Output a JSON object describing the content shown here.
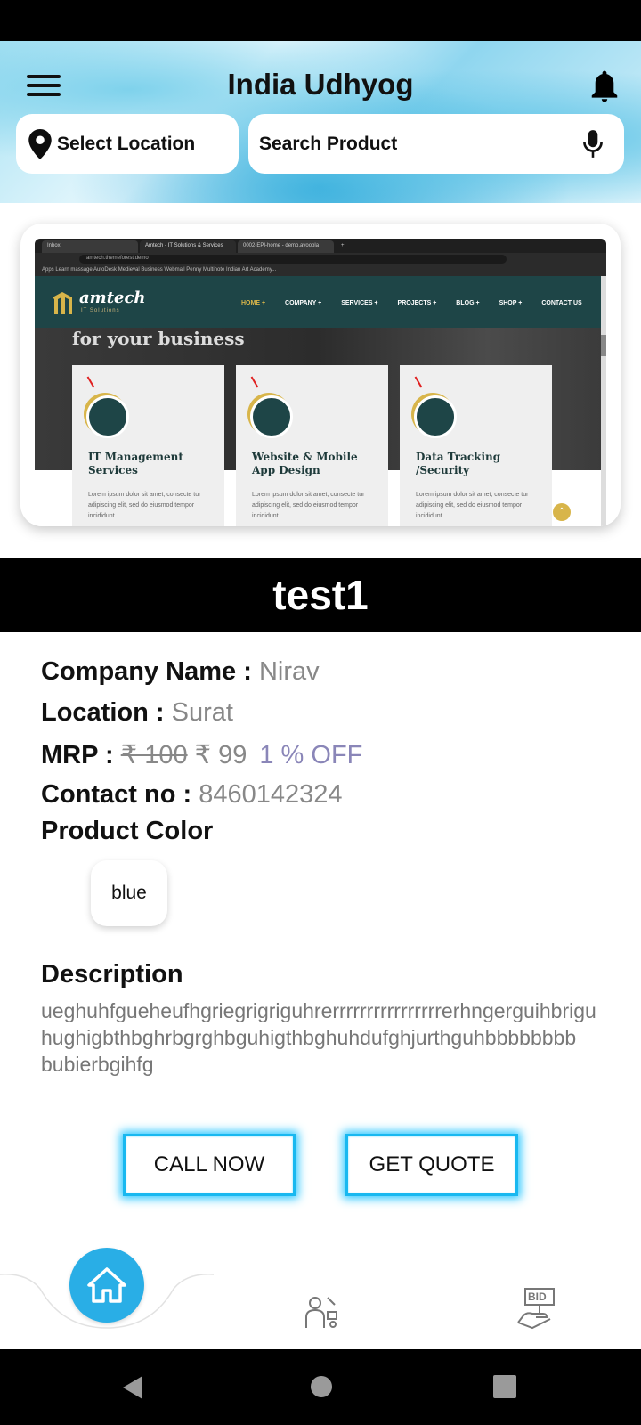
{
  "header": {
    "app_title": "India Udhyog",
    "location_label": "Select Location",
    "search_placeholder": "Search Product"
  },
  "banner": {
    "browser_tabs": [
      "Inbox",
      "Amtech - IT Solutions & Services",
      "0002-EPI-home - demo.avoopla",
      "+"
    ],
    "url": "amtech.themeforest.demo",
    "bookmarks": "Apps   Learn massage   AutoDesk   Medieval   Business Webmail   Penny   Multinote   Indian Art Academy...",
    "brand": "amtech",
    "brand_sub": "IT Solutions",
    "menu": [
      "HOME +",
      "COMPANY +",
      "SERVICES +",
      "PROJECTS +",
      "BLOG +",
      "SHOP +",
      "CONTACT US"
    ],
    "hero_text": "for your business",
    "cards": [
      {
        "title": "IT Management Services",
        "body": "Lorem ipsum dolor sit amet, consecte tur adipiscing elit, sed do eiusmod tempor incididunt."
      },
      {
        "title": "Website & Mobile App Design",
        "body": "Lorem ipsum dolor sit amet, consecte tur adipiscing elit, sed do eiusmod tempor incididunt."
      },
      {
        "title": "Data Tracking /Security",
        "body": "Lorem ipsum dolor sit amet, consecte tur adipiscing elit, sed do eiusmod tempor incididunt."
      }
    ]
  },
  "product": {
    "name": "test1",
    "company_label": "Company Name :",
    "company_value": "Nirav",
    "location_label": "Location :",
    "location_value": "Surat",
    "mrp_label": "MRP :",
    "mrp_old": "₹ 100",
    "mrp_new": "₹ 99",
    "discount": "1 % OFF",
    "contact_label": "Contact no :",
    "contact_value": "8460142324",
    "color_label": "Product Color",
    "colors": [
      "blue"
    ],
    "description_label": "Description",
    "description": "ueghuhfgueheufhgriegrigriguhrerrrrrrrrrrrrrrrrerhngerguihbrigu\nhughigbthbghrbgrghbguhigthbghuhdufghjurthguhbbbbbbbb\nbubierbgihfg"
  },
  "actions": {
    "call_now": "CALL NOW",
    "get_quote": "GET QUOTE"
  },
  "bottom_nav": {
    "items": [
      "home-icon",
      "worker-icon",
      "bid-icon"
    ],
    "bid_text": "BID"
  },
  "colors": {
    "accent": "#29aee6",
    "glow": "#2bc7ff",
    "discount": "#8a86b8",
    "dark_bar": "#000000"
  }
}
